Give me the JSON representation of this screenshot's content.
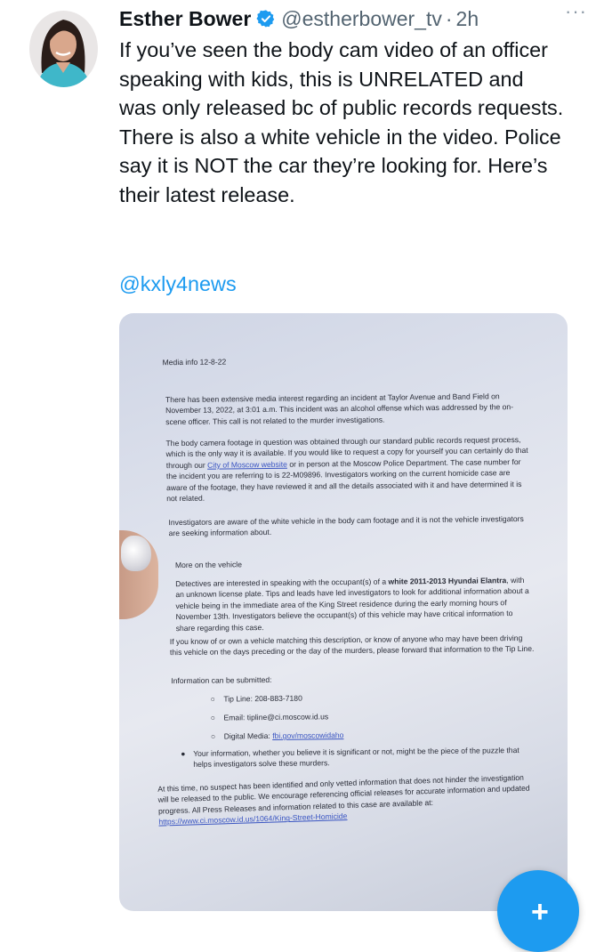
{
  "tweet": {
    "author_name": "Esther Bower",
    "author_handle": "@estherbower_tv",
    "separator": "·",
    "time": "2h",
    "more_label": "···",
    "text": "If you’ve seen the body cam video of an officer speaking with kids, this is UNRELATED and was only released bc of public records requests. There is also a white vehicle in the video. Police say it is NOT the car they’re looking for. Here’s their latest release.",
    "mention": "@kxly4news"
  },
  "document": {
    "header": "Media info 12-8-22",
    "p1": "There has been extensive media interest regarding an incident at Taylor Avenue and Band Field on November 13, 2022, at 3:01 a.m. This incident was an alcohol offense which was addressed by the on-scene officer. This call is not related to the murder investigations.",
    "p2a": "The body camera footage in question was obtained through our standard public records request process, which is the only way it is available. If you would like to request a copy for yourself you can certainly do that through our ",
    "p2_link": "City of Moscow website",
    "p2b": " or in person at the Moscow Police Department. The case number for the incident you are referring to is 22-M09896. Investigators working on the current homicide case are aware of the footage, they have reviewed it and all the details associated with it and have determined it is not related.",
    "p3": "Investigators are aware of the white vehicle in the body cam footage and it is not the vehicle investigators are seeking information about.",
    "section_title": "More on the vehicle",
    "p4a": "Detectives are interested in speaking with the occupant(s) of a ",
    "p4_bold": "white 2011-2013 Hyundai Elantra",
    "p4b": ", with an unknown license plate. Tips and leads have led investigators to look for additional information about a vehicle being in the immediate area of the King Street residence during the early morning hours of November 13th. Investigators believe the occupant(s) of this vehicle may have critical information to share regarding this case.",
    "p5": "If you know of or own a vehicle matching this description, or know of anyone who may have been driving this vehicle on the days preceding or the day of the murders, please forward that information to the Tip Line.",
    "info_label": "Information can be submitted:",
    "tip_line": "Tip Line: 208-883-7180",
    "email": "Email: tipline@ci.moscow.id.us",
    "digital_label": "Digital Media: ",
    "digital_link": "fbi.gov/moscowidaho",
    "bullet": "Your information, whether you believe it is significant or not, might be the piece of the puzzle that helps investigators solve these murders.",
    "p6": "At this time, no suspect has been identified and only vetted information that does not hinder the investigation will be released to the public. We encourage referencing official releases for accurate information and updated progress. All Press Releases and information related to this case are available at: ",
    "p6_link": "https://www.ci.moscow.id.us/1064/King-Street-Homicide"
  },
  "colors": {
    "accent": "#1d9bf0",
    "text": "#0f1419",
    "muted": "#536471"
  },
  "icons": {
    "verified": "verified-badge-icon",
    "compose": "plus-icon"
  }
}
